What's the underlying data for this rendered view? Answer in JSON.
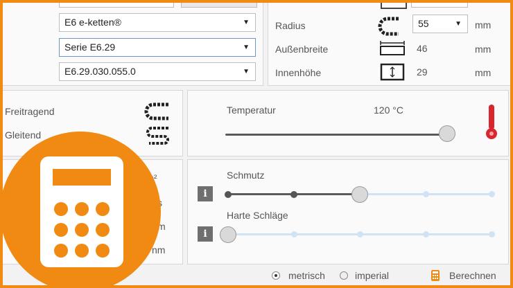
{
  "selection": {
    "product": "E6 e-ketten®",
    "series": "Serie E6.29",
    "part": "E6.29.030.055.0"
  },
  "dimensions": [
    {
      "label": "Radius",
      "value": "55",
      "unit": "mm",
      "icon": "radius-icon"
    },
    {
      "label": "Außenbreite",
      "value": "46",
      "unit": "mm",
      "icon": "outer-width-icon"
    },
    {
      "label": "Innenhöhe",
      "value": "29",
      "unit": "mm",
      "icon": "inner-height-icon"
    }
  ],
  "install": {
    "options": [
      {
        "label": "Freitragend",
        "icon": "unsupported-chain-icon"
      },
      {
        "label": "Gleitend",
        "icon": "gliding-chain-icon"
      }
    ]
  },
  "temperature": {
    "label": "Temperatur",
    "value": "120 °C",
    "level": 0.97,
    "icon": "thermometer-icon",
    "color": "#d9262e"
  },
  "motion_units": [
    "/s²",
    "s",
    "m",
    "nm"
  ],
  "environment": {
    "dirt": {
      "label": "Schmutz",
      "level_step": 2,
      "steps": 5
    },
    "impact": {
      "label": "Harte Schläge",
      "level_step": 0,
      "steps": 5
    }
  },
  "units": {
    "metric": "metrisch",
    "imperial": "imperial",
    "selected": "metrisch"
  },
  "calculate": {
    "label": "Berechnen",
    "icon": "calculator-icon"
  },
  "badge": {
    "icon": "calculator-icon",
    "color": "#f08a12"
  },
  "colors": {
    "accent": "#f08a12",
    "border": "#d6d6d6"
  }
}
